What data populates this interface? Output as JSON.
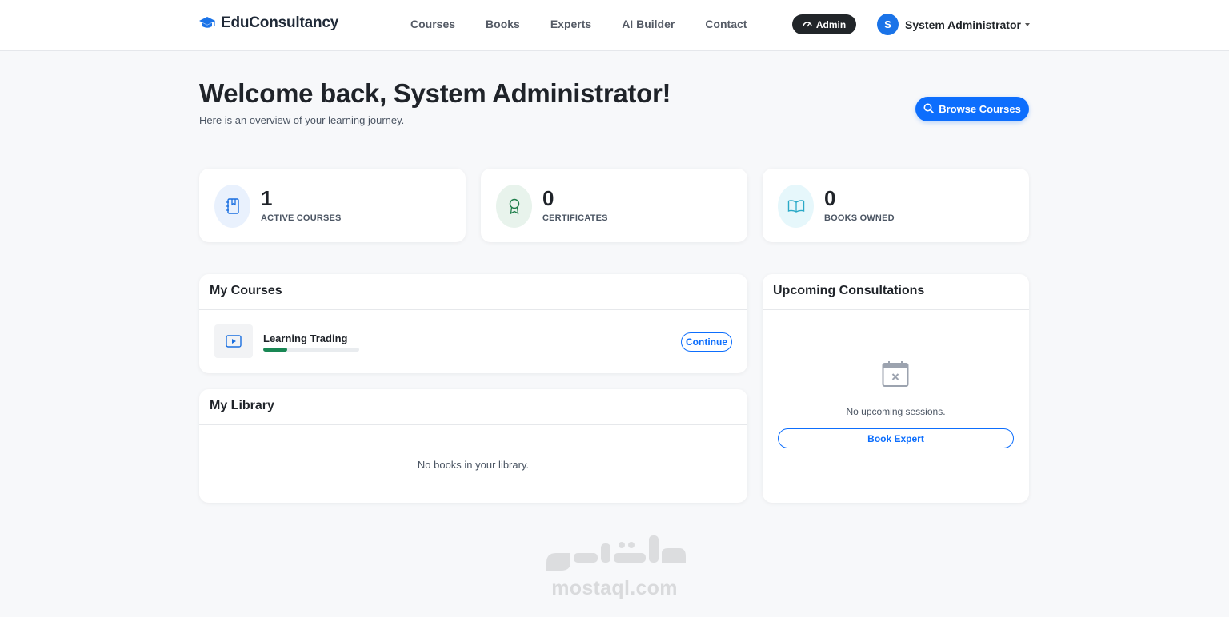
{
  "brand": {
    "name": "EduConsultancy",
    "icon": "graduation-cap-icon"
  },
  "nav": {
    "links": [
      "Courses",
      "Books",
      "Experts",
      "AI Builder",
      "Contact"
    ],
    "admin_badge": "Admin",
    "user_initial": "S",
    "user_name": "System Administrator"
  },
  "header": {
    "title": "Welcome back, System Administrator!",
    "subtitle": "Here is an overview of your learning journey.",
    "browse_button": "Browse Courses"
  },
  "stats": [
    {
      "value": "1",
      "label": "ACTIVE COURSES",
      "icon": "journal-bookmark-icon",
      "icon_color": "#1a6fe0",
      "icon_bg": "#e9f1fd"
    },
    {
      "value": "0",
      "label": "CERTIFICATES",
      "icon": "award-icon",
      "icon_color": "#1e7e4a",
      "icon_bg": "#e8f3ec"
    },
    {
      "value": "0",
      "label": "BOOKS OWNED",
      "icon": "book-open-icon",
      "icon_color": "#29a9c7",
      "icon_bg": "#e6f7fb"
    }
  ],
  "my_courses": {
    "title": "My Courses",
    "items": [
      {
        "name": "Learning Trading",
        "progress": 0.25,
        "button": "Continue",
        "icon": "play-video-icon"
      }
    ]
  },
  "my_library": {
    "title": "My Library",
    "empty_text": "No books in your library."
  },
  "consultations": {
    "title": "Upcoming Consultations",
    "empty_text": "No upcoming sessions.",
    "button": "Book Expert",
    "icon": "calendar-x-icon"
  },
  "watermark": {
    "text": "mostaql.com"
  },
  "colors": {
    "primary": "#0d6efd",
    "success": "#198754",
    "dark": "#212529"
  }
}
